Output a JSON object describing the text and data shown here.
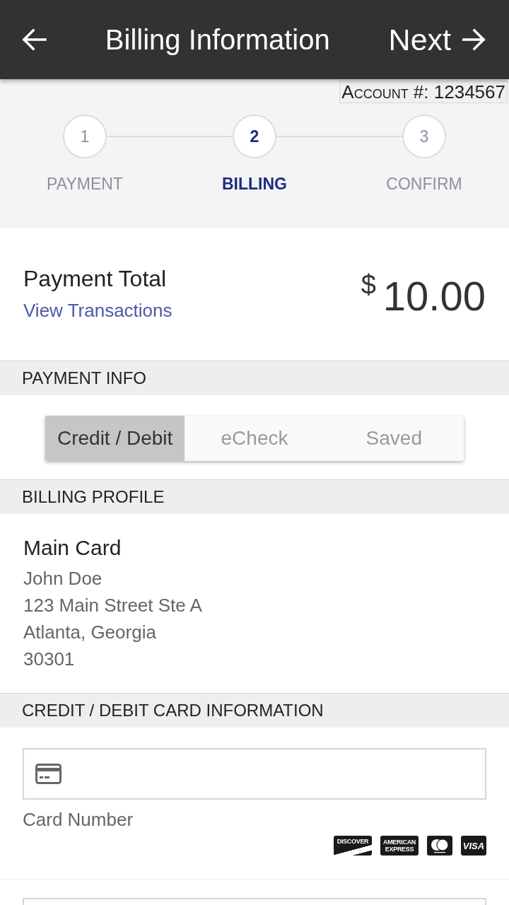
{
  "header": {
    "title": "Billing Information",
    "next_label": "Next"
  },
  "account": "Account #: 1234567",
  "steps": [
    {
      "number": "1",
      "label": "PAYMENT",
      "selected": false
    },
    {
      "number": "2",
      "label": "BILLING",
      "selected": true
    },
    {
      "number": "3",
      "label": "CONFIRM",
      "selected": false
    }
  ],
  "payment_total": {
    "label": "Payment Total",
    "link": "View Transactions",
    "currency": "$",
    "amount": "10.00"
  },
  "payment_info": {
    "heading": "PAYMENT INFO",
    "methods": [
      {
        "label": "Credit / Debit",
        "selected": true
      },
      {
        "label": "eCheck",
        "selected": false
      },
      {
        "label": "Saved",
        "selected": false
      }
    ]
  },
  "billing_profile": {
    "heading": "BILLING PROFILE",
    "title": "Main Card",
    "lines": [
      "John Doe",
      "123 Main Street Ste A",
      "Atlanta, Georgia",
      "30301"
    ]
  },
  "card_info": {
    "heading": "CREDIT / DEBIT CARD INFORMATION",
    "card_number_label": "Card Number",
    "card_brands": [
      {
        "kind": "discover",
        "label": "DISCOVER"
      },
      {
        "kind": "amex",
        "label": "AMERICAN EXPRESS"
      },
      {
        "kind": "mastercard"
      },
      {
        "kind": "visa",
        "label": "VISA"
      }
    ]
  }
}
